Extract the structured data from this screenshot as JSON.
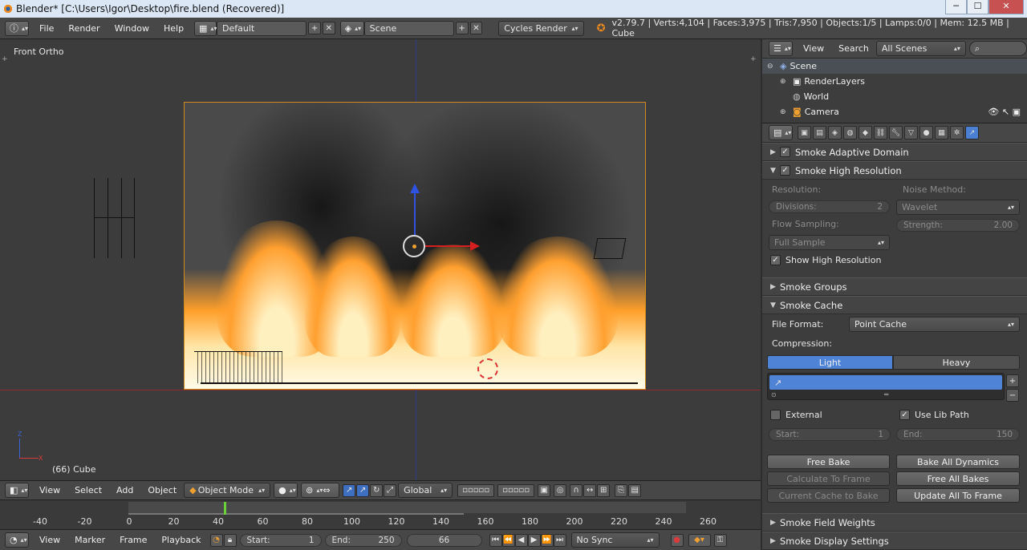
{
  "window": {
    "title": "Blender* [C:\\Users\\Igor\\Desktop\\fire.blend (Recovered)]",
    "min": "─",
    "max": "☐",
    "close": "✕"
  },
  "info": {
    "menus": [
      "File",
      "Render",
      "Window",
      "Help"
    ],
    "layout": "Default",
    "scene": "Scene",
    "engine": "Cycles Render",
    "stats": "v2.79.7 | Verts:4,104 | Faces:3,975 | Tris:7,950 | Objects:1/5 | Lamps:0/0 | Mem: 12.5 MB | Cube"
  },
  "viewport": {
    "view_name": "Front Ortho",
    "object_label": "(66) Cube",
    "axis_z": "Z",
    "axis_x": "X"
  },
  "view3d_header": {
    "menus": [
      "View",
      "Select",
      "Add",
      "Object"
    ],
    "mode": "Object Mode",
    "orientation": "Global"
  },
  "timeline": {
    "ticks": [
      "-40",
      "-20",
      "0",
      "20",
      "40",
      "60",
      "80",
      "100",
      "120",
      "140",
      "160",
      "180",
      "200",
      "220",
      "240",
      "260"
    ],
    "current_frame_fraction": 0.066,
    "menus": [
      "View",
      "Marker",
      "Frame",
      "Playback"
    ],
    "start_label": "Start:",
    "start": "1",
    "end_label": "End:",
    "end": "250",
    "current": "66",
    "sync": "No Sync"
  },
  "outliner": {
    "menus": [
      "View",
      "Search"
    ],
    "filter": "All Scenes",
    "items": [
      "Scene",
      "RenderLayers",
      "World",
      "Camera"
    ]
  },
  "properties": {
    "adaptive": "Smoke Adaptive Domain",
    "highres": "Smoke High Resolution",
    "resolution_label": "Resolution:",
    "noise_label": "Noise Method:",
    "divisions_label": "Divisions:",
    "divisions": "2",
    "noise": "Wavelet",
    "flow_label": "Flow Sampling:",
    "strength_label": "Strength:",
    "strength": "2.00",
    "flow": "Full Sample",
    "show_highres": "Show High Resolution",
    "groups": "Smoke Groups",
    "cache": "Smoke Cache",
    "file_format_label": "File Format:",
    "file_format": "Point Cache",
    "compression_label": "Compression:",
    "light": "Light",
    "heavy": "Heavy",
    "external": "External",
    "use_lib": "Use Lib Path",
    "start_label": "Start:",
    "start": "1",
    "end_label": "End:",
    "end": "150",
    "free_bake": "Free Bake",
    "bake_all": "Bake All Dynamics",
    "calc_frame": "Calculate To Frame",
    "free_all": "Free All Bakes",
    "cur_bake": "Current Cache to Bake",
    "update_all": "Update All To Frame",
    "field_weights": "Smoke Field Weights",
    "display": "Smoke Display Settings"
  }
}
